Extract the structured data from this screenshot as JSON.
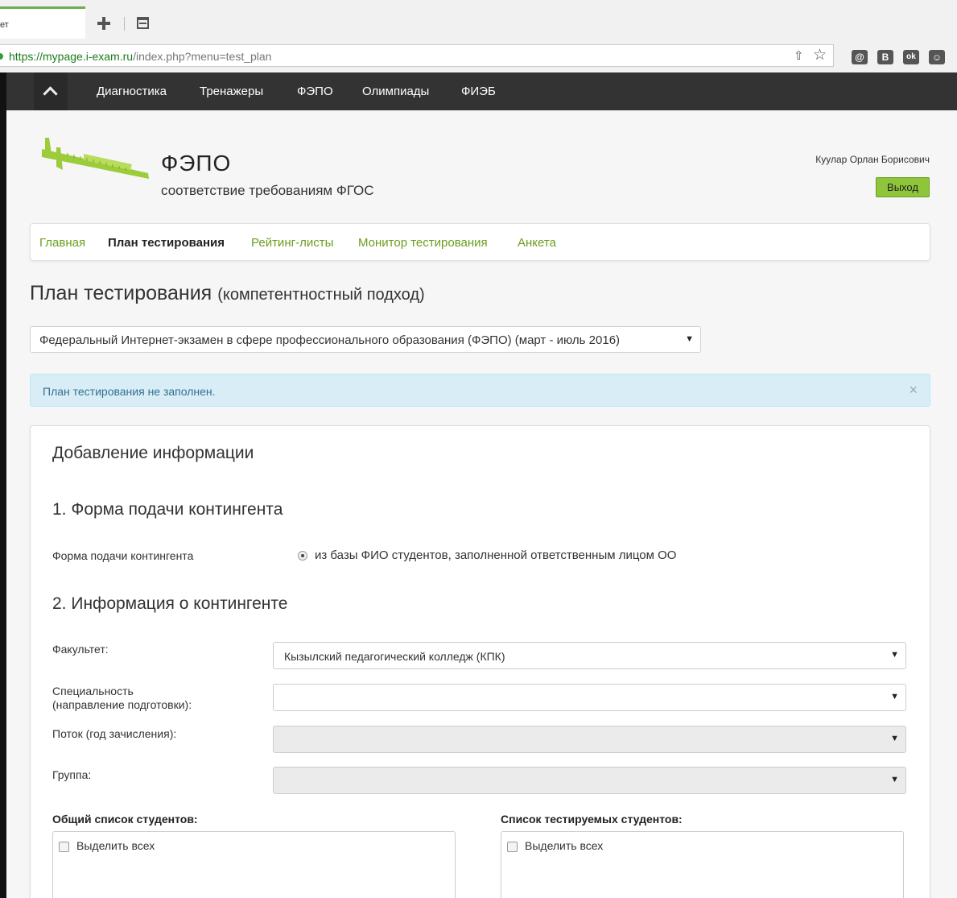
{
  "browser": {
    "tab_title": "ет",
    "url_host": "https://mypage.i-exam.ru",
    "url_path": "/index.php?menu=test_plan",
    "extensions": [
      "@",
      "B",
      "ok",
      "☺"
    ]
  },
  "navbar": {
    "items": [
      "Диагностика",
      "Тренажеры",
      "ФЭПО",
      "Олимпиады",
      "ФИЭБ"
    ]
  },
  "header": {
    "title": "ФЭПО",
    "subtitle": "соответствие требованиям ФГОС",
    "user_name": "Куулар Орлан Борисович",
    "logout_label": "Выход"
  },
  "subnav": {
    "items": [
      "Главная",
      "План тестирования",
      "Рейтинг-листы",
      "Монитор тестирования",
      "Анкета"
    ],
    "active": "План тестирования"
  },
  "page": {
    "title_main": "План тестирования",
    "title_small": "(компетентностный подход)",
    "exam_select": "Федеральный Интернет-экзамен в сфере профессионального образования (ФЭПО) (март - июль 2016)",
    "alert": "План тестирования не заполнен.",
    "alert_close": "×"
  },
  "panel": {
    "heading": "Добавление информации",
    "section1": "1. Форма подачи контингента",
    "form_label": "Форма подачи контингента",
    "form_option": "из базы ФИО студентов, заполненной ответственным лицом ОО",
    "section2": "2. Информация о контингенте",
    "faculty_label": "Факультет:",
    "faculty_value": "Кызылский педагогический колледж (КПК)",
    "specialty_label_1": "Специальность",
    "specialty_label_2": "(направление подготовки):",
    "stream_label": "Поток (год зачисления):",
    "group_label": "Группа:",
    "all_students_title": "Общий список студентов:",
    "tested_students_title": "Список тестируемых студентов:",
    "select_all": "Выделить всех"
  },
  "colors": {
    "accent_green": "#8fc53a",
    "link_green": "#6a9f1e",
    "navbar": "#333333",
    "alert_bg": "#d9edf7"
  }
}
